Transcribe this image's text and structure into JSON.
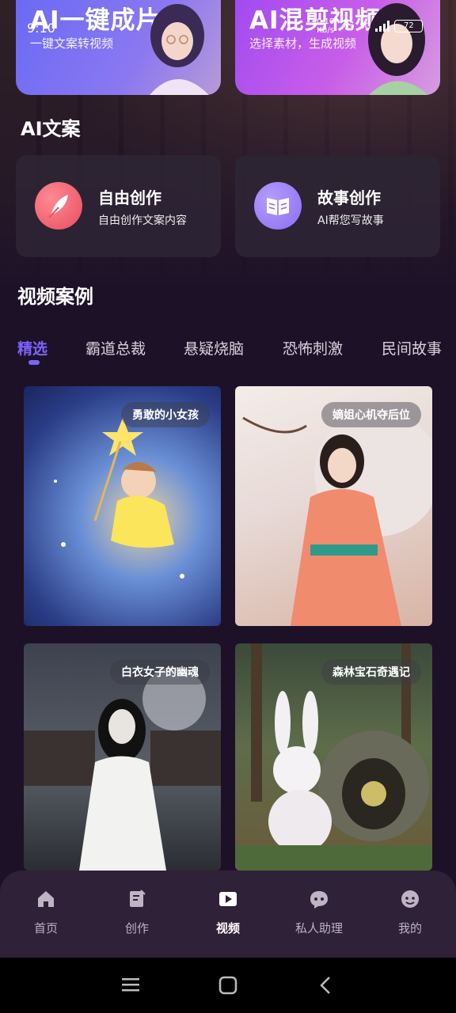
{
  "status_bar": {
    "time": "9:10",
    "speed_value": "0.10",
    "speed_unit": "KB/s",
    "network": "5G",
    "battery": "72"
  },
  "promos": [
    {
      "title": "AI一键成片",
      "subtitle": "一键文案转视频"
    },
    {
      "title": "AI混剪视频",
      "subtitle": "选择素材，生成视频"
    }
  ],
  "ai_copy": {
    "title": "AI文案",
    "tools": [
      {
        "name": "自由创作",
        "desc": "自由创作文案内容",
        "icon": "feather-icon"
      },
      {
        "name": "故事创作",
        "desc": "AI帮您写故事",
        "icon": "book-icon"
      }
    ]
  },
  "video_cases": {
    "title": "视频案例",
    "tabs": [
      "精选",
      "霸道总裁",
      "悬疑烧脑",
      "恐怖刺激",
      "民间故事"
    ],
    "active_tab": "精选",
    "cases": [
      {
        "label": "勇敢的小女孩"
      },
      {
        "label": "嫡姐心机夺后位"
      },
      {
        "label": "白衣女子的幽魂"
      },
      {
        "label": "森林宝石奇遇记"
      }
    ]
  },
  "bottom_nav": {
    "items": [
      {
        "label": "首页",
        "icon": "home-icon"
      },
      {
        "label": "创作",
        "icon": "edit-doc-icon"
      },
      {
        "label": "视频",
        "icon": "play-icon"
      },
      {
        "label": "私人助理",
        "icon": "chat-icon"
      },
      {
        "label": "我的",
        "icon": "profile-icon"
      }
    ],
    "active": "视频"
  },
  "colors": {
    "background": "#1d1128",
    "accent": "#7b63ff",
    "card": "#2d2434",
    "nav": "#2f2138"
  }
}
